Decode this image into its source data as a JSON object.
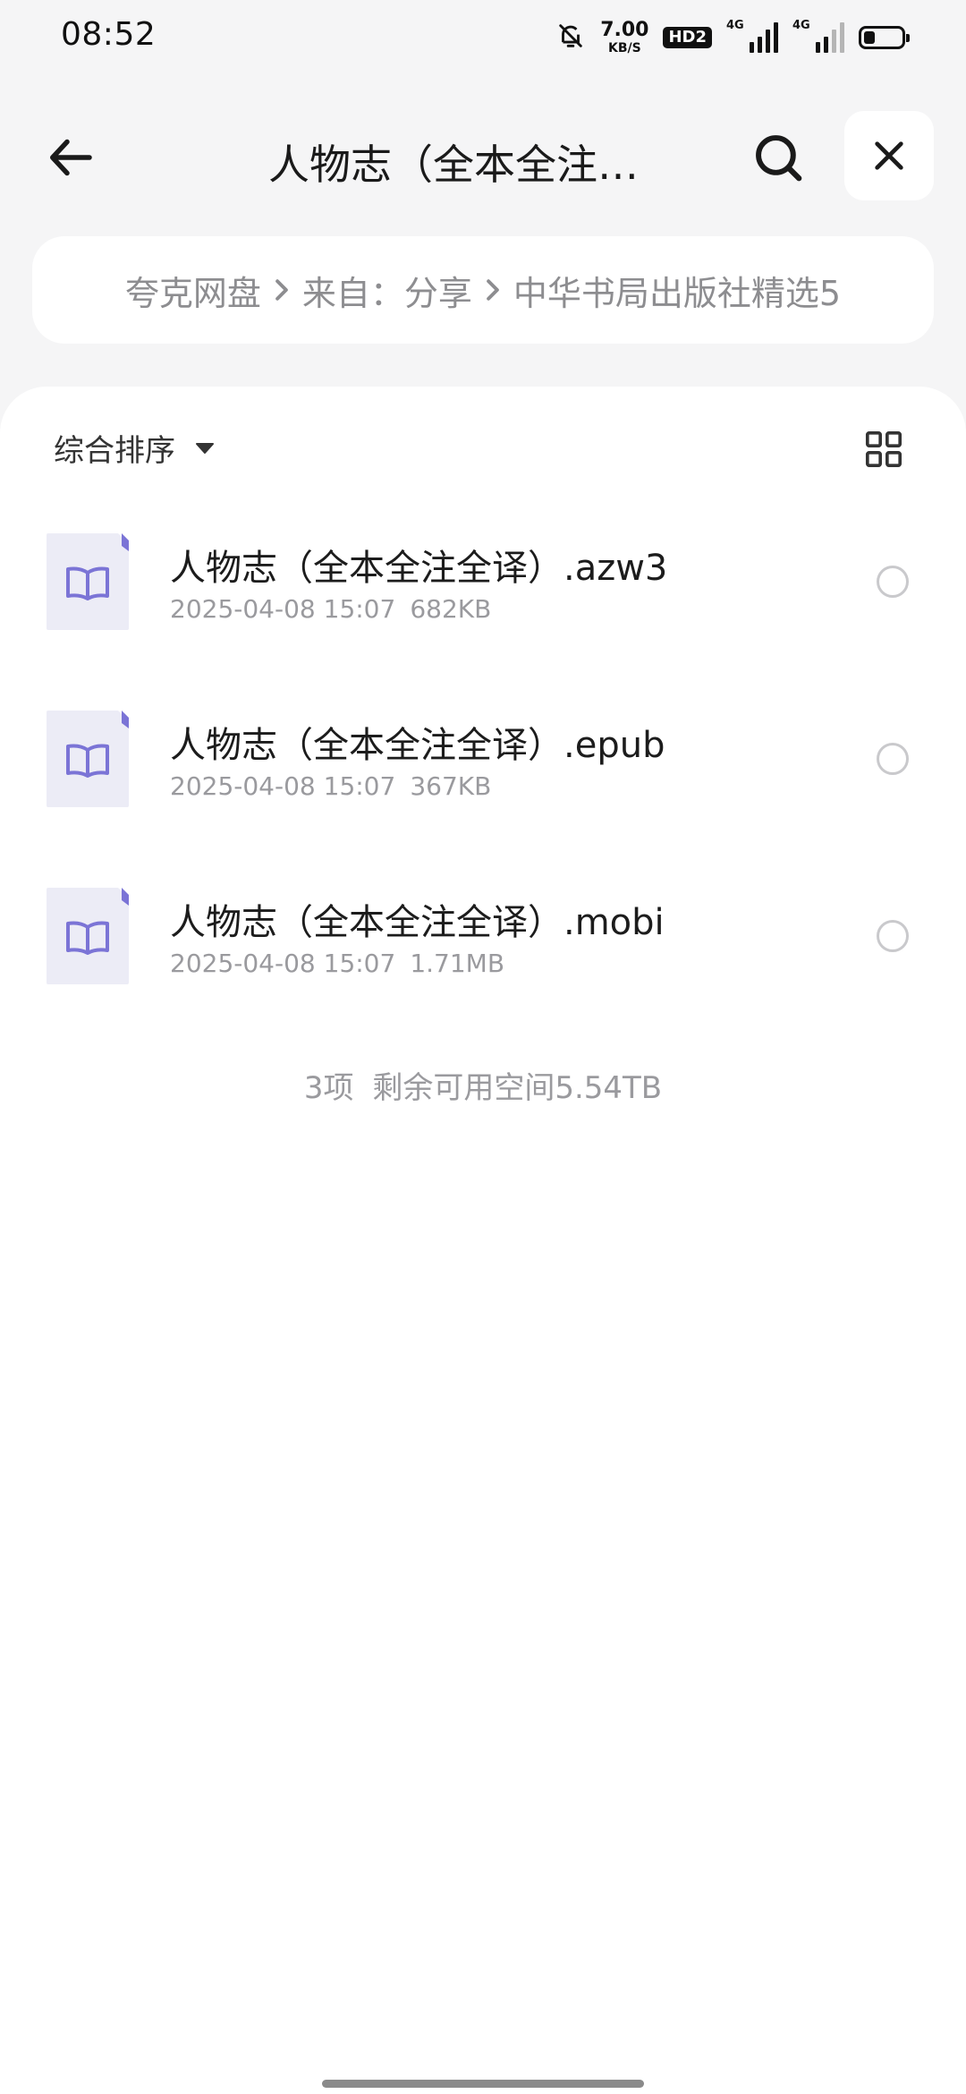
{
  "status_bar": {
    "time": "08:52",
    "net_speed_value": "7.00",
    "net_speed_unit": "KB/S",
    "hd_label": "HD2",
    "sim1_label": "4G",
    "sim2_label": "4G",
    "icons": [
      "bell-off-icon",
      "signal-icon",
      "battery-icon"
    ],
    "battery_level": 0.3
  },
  "header": {
    "title": "人物志（全本全注…",
    "back_icon": "arrow-left-icon",
    "search_icon": "search-icon",
    "close_icon": "close-icon"
  },
  "breadcrumb": {
    "items": [
      "夸克网盘",
      "来自：分享",
      "中华书局出版社精选5"
    ],
    "separator_icon": "chevron-right-icon"
  },
  "toolbar": {
    "sort_label": "综合排序",
    "sort_icon": "caret-down-icon",
    "view_icon": "grid-view-icon"
  },
  "files": [
    {
      "name": "人物志（全本全注全译）.azw3",
      "date": "2025-04-08 15:07",
      "size": "682KB",
      "icon": "ebook-icon"
    },
    {
      "name": "人物志（全本全注全译）.epub",
      "date": "2025-04-08 15:07",
      "size": "367KB",
      "icon": "ebook-icon"
    },
    {
      "name": "人物志（全本全注全译）.mobi",
      "date": "2025-04-08 15:07",
      "size": "1.71MB",
      "icon": "ebook-icon"
    }
  ],
  "summary": {
    "count": "3项",
    "space": "剩余可用空间5.54TB"
  },
  "colors": {
    "background": "#f5f5f6",
    "card": "#ffffff",
    "accent": "#7b74d6",
    "muted_text": "#9a9a9e"
  }
}
